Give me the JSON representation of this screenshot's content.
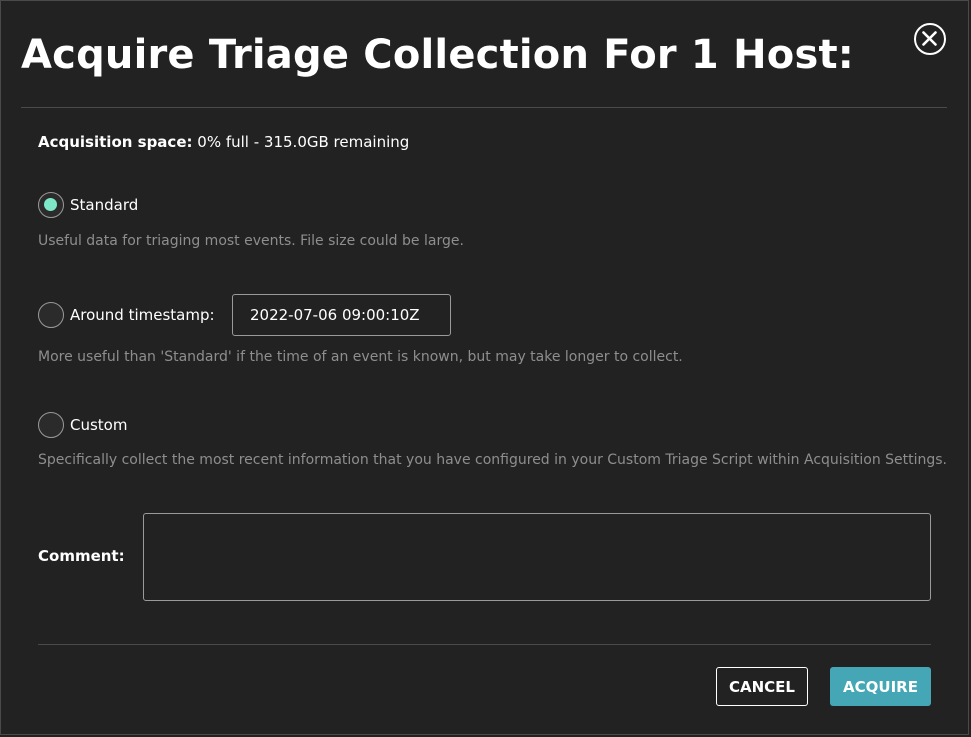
{
  "dialog": {
    "title": "Acquire Triage Collection For 1 Host:"
  },
  "acquisition_space": {
    "label": "Acquisition space:",
    "value": "0% full - 315.0GB remaining"
  },
  "options": [
    {
      "label": "Standard",
      "checked": true,
      "description": "Useful data for triaging most events. File size could be large."
    },
    {
      "label": "Around timestamp:",
      "checked": false,
      "timestamp_value": "2022-07-06 09:00:10Z",
      "description": "More useful than 'Standard' if the time of an event is known, but may take longer to collect."
    },
    {
      "label": "Custom",
      "checked": false,
      "description": "Specifically collect the most recent information that you have configured in your Custom Triage Script within Acquisition Settings."
    }
  ],
  "comment": {
    "label": "Comment:",
    "value": ""
  },
  "buttons": {
    "cancel": "CANCEL",
    "acquire": "ACQUIRE"
  },
  "icons": {
    "close": "close-circle-icon"
  },
  "colors": {
    "background": "#222222",
    "radio_selected": "#7de7c7",
    "primary_button": "#45a7b6",
    "muted_text": "#8e8e8e",
    "divider": "#4a4a4a"
  }
}
